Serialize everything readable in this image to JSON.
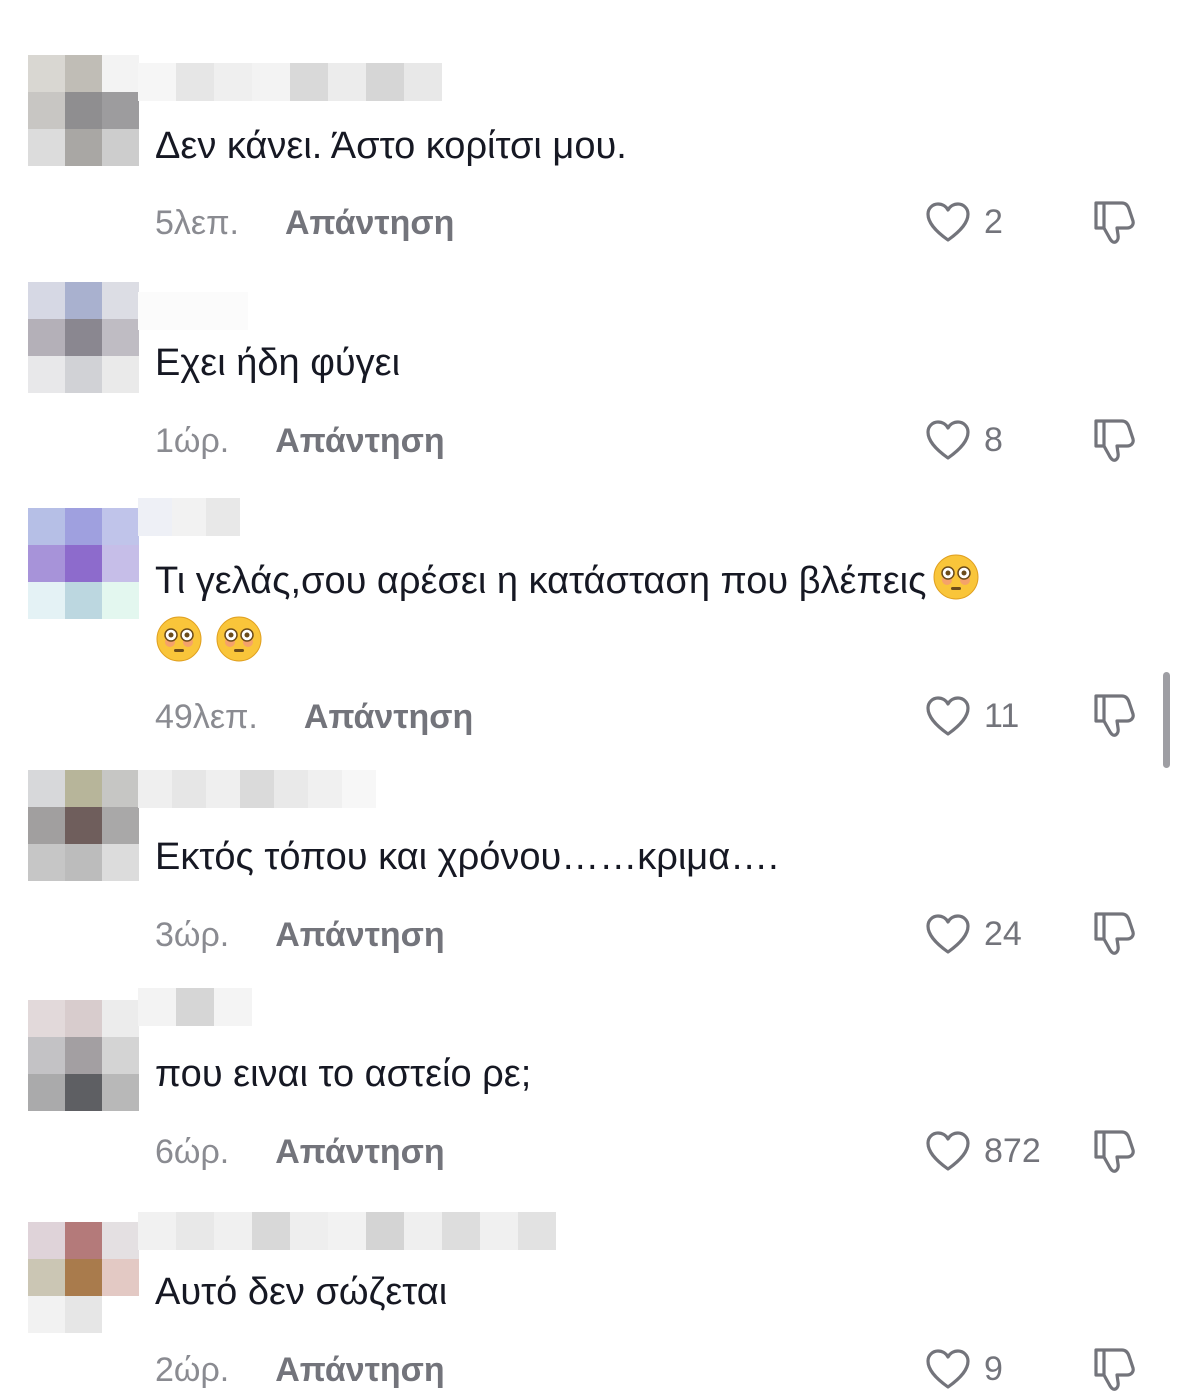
{
  "comments": [
    {
      "text": "Δεν κάνει. Άστο κορίτσι μου.",
      "time": "5λεπ.",
      "reply_label": "Απάντηση",
      "likes": "2",
      "avatar_colors": [
        "#d9d7d2",
        "#c0bdb6",
        "#f3f3f3",
        "#c8c6c3",
        "#8f8e90",
        "#9d9c9e",
        "#dcdcdc",
        "#a9a7a4",
        "#cdcdcd"
      ]
    },
    {
      "text": "Εχει ήδη φύγει",
      "time": "1ώρ.",
      "reply_label": "Απάντηση",
      "likes": "8",
      "avatar_colors": [
        "#d6d8e4",
        "#a9b1cf",
        "#dcdde4",
        "#b4b0b8",
        "#8a8790",
        "#bfbcc3",
        "#e8e8ea",
        "#d1d2d6",
        "#eaeaea"
      ]
    },
    {
      "text": "Τι γελάς,σου αρέσει η κατάσταση που βλέπεις",
      "time": "49λεπ.",
      "reply_label": "Απάντηση",
      "likes": "11",
      "emoji": "flushed-face-emoji",
      "avatar_colors": [
        "#b6bfe6",
        "#9fa0df",
        "#c0c4ea",
        "#a793d9",
        "#8d6bcc",
        "#c6bee8",
        "#e4f2f5",
        "#bcd7e0",
        "#e3f7ef"
      ]
    },
    {
      "text": "Εκτός τόπου και χρόνου……κριμα….",
      "time": "3ώρ.",
      "reply_label": "Απάντηση",
      "likes": "24",
      "avatar_colors": [
        "#d7d8da",
        "#b7b59a",
        "#c6c6c4",
        "#a19f9f",
        "#6f5e5c",
        "#a9a8a8",
        "#c6c6c6",
        "#bcbcbc",
        "#dcdcdc"
      ]
    },
    {
      "text": "που ειναι το αστείο ρε;",
      "time": "6ώρ.",
      "reply_label": "Απάντηση",
      "likes": "872",
      "avatar_colors": [
        "#e2d9da",
        "#d8cccd",
        "#ececec",
        "#c3c2c5",
        "#a39fa2",
        "#d4d4d4",
        "#aaaaab",
        "#5e5f63",
        "#b8b8b8"
      ]
    },
    {
      "text": "Αυτό δεν σώζεται",
      "time": "2ώρ.",
      "reply_label": "Απάντηση",
      "likes": "9",
      "avatar_colors": [
        "#dfd3d9",
        "#b47a7a",
        "#e4e0e2",
        "#cbc6b4",
        "#a97b4c",
        "#e3c9c4",
        "#f2f2f2",
        "#e6e6e6",
        "#ffffff"
      ]
    }
  ]
}
